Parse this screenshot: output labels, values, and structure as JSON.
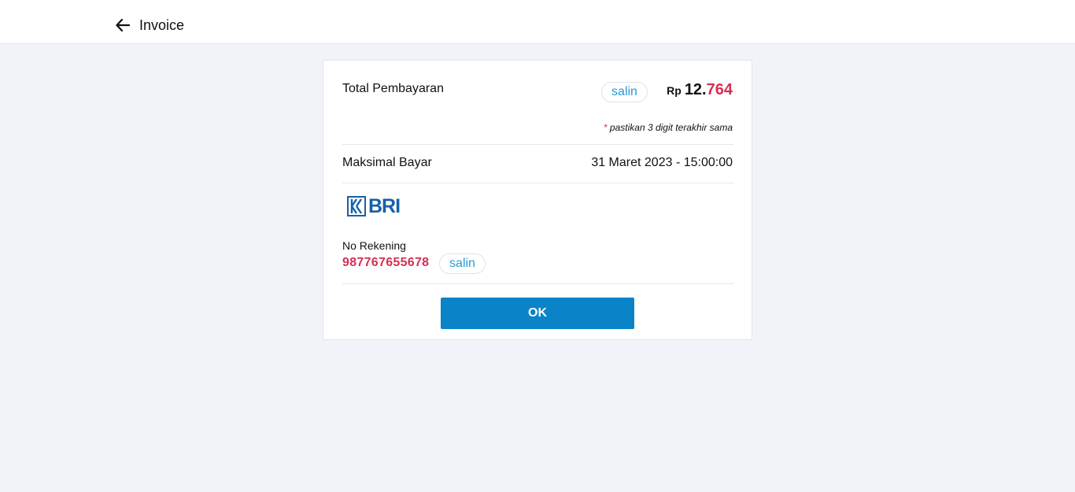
{
  "header": {
    "title": "Invoice",
    "back_icon": "arrow-left-icon"
  },
  "invoice": {
    "total_label": "Total Pembayaran",
    "copy_label": "salin",
    "currency": "Rp",
    "amount_main": "12.",
    "amount_last_digits": "764",
    "note_star": "*",
    "note_text": "pastikan 3 digit terakhir sama",
    "deadline_label": "Maksimal Bayar",
    "deadline_value": "31 Maret 2023 - 15:00:00",
    "bank_logo_text": "BRI",
    "account_label": "No Rekening",
    "account_number": "987767655678",
    "account_copy_label": "salin",
    "ok_label": "OK"
  },
  "colors": {
    "accent": "#0a83c9",
    "highlight": "#d62f55",
    "link": "#2a9ad6",
    "bank_brand": "#1561a8",
    "background": "#f0f3f7"
  }
}
